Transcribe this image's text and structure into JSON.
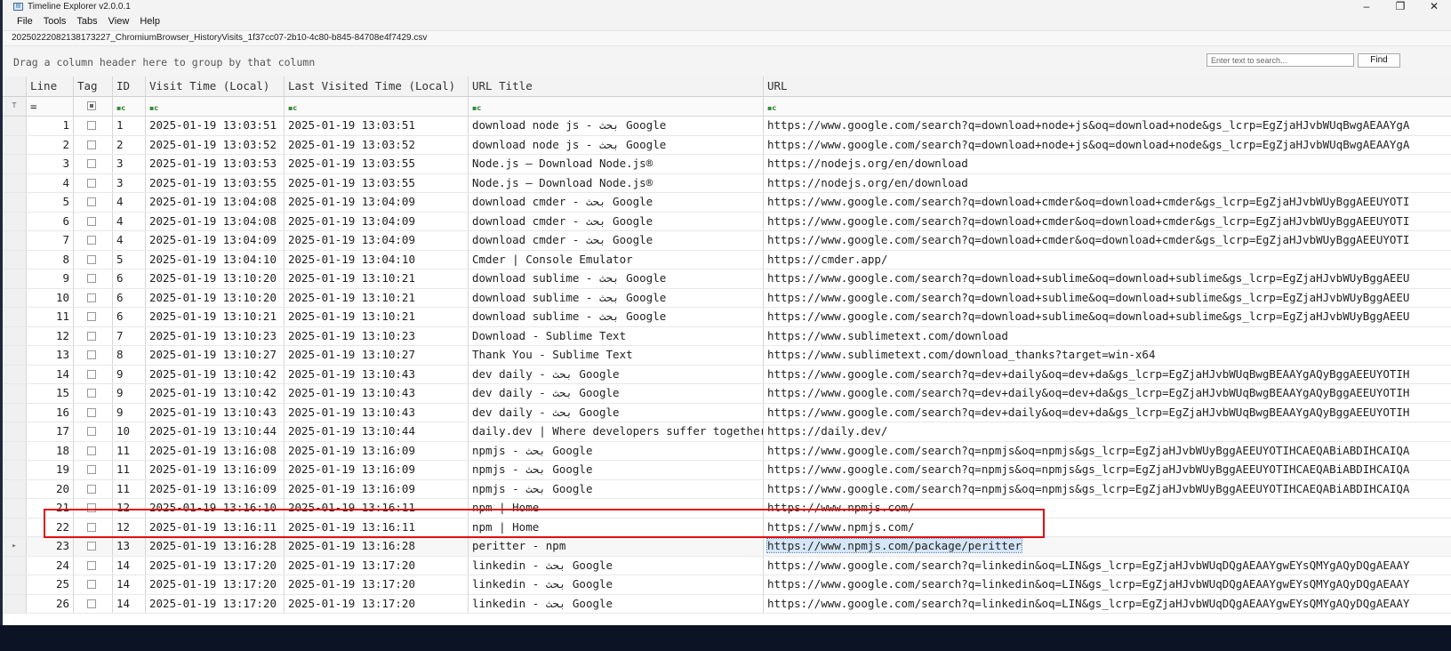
{
  "window": {
    "title": "Timeline Explorer v2.0.0.1",
    "controls": {
      "minimize": "–",
      "restore": "❐",
      "close": "✕"
    }
  },
  "menu": [
    "File",
    "Tools",
    "Tabs",
    "View",
    "Help"
  ],
  "file_tab": "20250222082138173227_ChromiumBrowser_HistoryVisits_1f37cc07-2b10-4c80-b845-84708e4f7429.csv",
  "group_hint": "Drag a column header here to group by that column",
  "search": {
    "placeholder": "Enter text to search...",
    "find_label": "Find"
  },
  "columns": {
    "line": "Line",
    "tag": "Tag",
    "id": "ID",
    "visit_time": "Visit Time (Local)",
    "last_visited": "Last Visited Time (Local)",
    "url_title": "URL Title",
    "url": "URL"
  },
  "filter_row": {
    "funnel": "⊤",
    "line_op": "=",
    "text_op": "▪c"
  },
  "rows": [
    {
      "line": "1",
      "id": "1",
      "visit": "2025-01-19 13:03:51",
      "last": "2025-01-19 13:03:51",
      "title": "download node js - بحث Google",
      "url": "https://www.google.com/search?q=download+node+js&oq=download+node&gs_lcrp=EgZjaHJvbWUqBwgAEAAYgA"
    },
    {
      "line": "2",
      "id": "2",
      "visit": "2025-01-19 13:03:52",
      "last": "2025-01-19 13:03:52",
      "title": "download node js - بحث Google",
      "url": "https://www.google.com/search?q=download+node+js&oq=download+node&gs_lcrp=EgZjaHJvbWUqBwgAEAAYgA"
    },
    {
      "line": "3",
      "id": "3",
      "visit": "2025-01-19 13:03:53",
      "last": "2025-01-19 13:03:55",
      "title": "Node.js — Download Node.js®",
      "url": "https://nodejs.org/en/download"
    },
    {
      "line": "4",
      "id": "3",
      "visit": "2025-01-19 13:03:55",
      "last": "2025-01-19 13:03:55",
      "title": "Node.js — Download Node.js®",
      "url": "https://nodejs.org/en/download"
    },
    {
      "line": "5",
      "id": "4",
      "visit": "2025-01-19 13:04:08",
      "last": "2025-01-19 13:04:09",
      "title": "download cmder - بحث Google",
      "url": "https://www.google.com/search?q=download+cmder&oq=download+cmder&gs_lcrp=EgZjaHJvbWUyBggAEEUYOTI"
    },
    {
      "line": "6",
      "id": "4",
      "visit": "2025-01-19 13:04:08",
      "last": "2025-01-19 13:04:09",
      "title": "download cmder - بحث Google",
      "url": "https://www.google.com/search?q=download+cmder&oq=download+cmder&gs_lcrp=EgZjaHJvbWUyBggAEEUYOTI"
    },
    {
      "line": "7",
      "id": "4",
      "visit": "2025-01-19 13:04:09",
      "last": "2025-01-19 13:04:09",
      "title": "download cmder - بحث Google",
      "url": "https://www.google.com/search?q=download+cmder&oq=download+cmder&gs_lcrp=EgZjaHJvbWUyBggAEEUYOTI"
    },
    {
      "line": "8",
      "id": "5",
      "visit": "2025-01-19 13:04:10",
      "last": "2025-01-19 13:04:10",
      "title": "Cmder | Console Emulator",
      "url": "https://cmder.app/"
    },
    {
      "line": "9",
      "id": "6",
      "visit": "2025-01-19 13:10:20",
      "last": "2025-01-19 13:10:21",
      "title": "download sublime - بحث Google",
      "url": "https://www.google.com/search?q=download+sublime&oq=download+sublime&gs_lcrp=EgZjaHJvbWUyBggAEEU"
    },
    {
      "line": "10",
      "id": "6",
      "visit": "2025-01-19 13:10:20",
      "last": "2025-01-19 13:10:21",
      "title": "download sublime - بحث Google",
      "url": "https://www.google.com/search?q=download+sublime&oq=download+sublime&gs_lcrp=EgZjaHJvbWUyBggAEEU"
    },
    {
      "line": "11",
      "id": "6",
      "visit": "2025-01-19 13:10:21",
      "last": "2025-01-19 13:10:21",
      "title": "download sublime - بحث Google",
      "url": "https://www.google.com/search?q=download+sublime&oq=download+sublime&gs_lcrp=EgZjaHJvbWUyBggAEEU"
    },
    {
      "line": "12",
      "id": "7",
      "visit": "2025-01-19 13:10:23",
      "last": "2025-01-19 13:10:23",
      "title": "Download - Sublime Text",
      "url": "https://www.sublimetext.com/download"
    },
    {
      "line": "13",
      "id": "8",
      "visit": "2025-01-19 13:10:27",
      "last": "2025-01-19 13:10:27",
      "title": "Thank You - Sublime Text",
      "url": "https://www.sublimetext.com/download_thanks?target=win-x64"
    },
    {
      "line": "14",
      "id": "9",
      "visit": "2025-01-19 13:10:42",
      "last": "2025-01-19 13:10:43",
      "title": "dev daily - بحث Google",
      "url": "https://www.google.com/search?q=dev+daily&oq=dev+da&gs_lcrp=EgZjaHJvbWUqBwgBEAAYgAQyBggAEEUYOTIH"
    },
    {
      "line": "15",
      "id": "9",
      "visit": "2025-01-19 13:10:42",
      "last": "2025-01-19 13:10:43",
      "title": "dev daily - بحث Google",
      "url": "https://www.google.com/search?q=dev+daily&oq=dev+da&gs_lcrp=EgZjaHJvbWUqBwgBEAAYgAQyBggAEEUYOTIH"
    },
    {
      "line": "16",
      "id": "9",
      "visit": "2025-01-19 13:10:43",
      "last": "2025-01-19 13:10:43",
      "title": "dev daily - بحث Google",
      "url": "https://www.google.com/search?q=dev+daily&oq=dev+da&gs_lcrp=EgZjaHJvbWUqBwgBEAAYgAQyBggAEEUYOTIH"
    },
    {
      "line": "17",
      "id": "10",
      "visit": "2025-01-19 13:10:44",
      "last": "2025-01-19 13:10:44",
      "title": "daily.dev | Where developers suffer together",
      "url": "https://daily.dev/"
    },
    {
      "line": "18",
      "id": "11",
      "visit": "2025-01-19 13:16:08",
      "last": "2025-01-19 13:16:09",
      "title": "npmjs - بحث Google",
      "url": "https://www.google.com/search?q=npmjs&oq=npmjs&gs_lcrp=EgZjaHJvbWUyBggAEEUYOTIHCAEQABiABDIHCAIQA"
    },
    {
      "line": "19",
      "id": "11",
      "visit": "2025-01-19 13:16:09",
      "last": "2025-01-19 13:16:09",
      "title": "npmjs - بحث Google",
      "url": "https://www.google.com/search?q=npmjs&oq=npmjs&gs_lcrp=EgZjaHJvbWUyBggAEEUYOTIHCAEQABiABDIHCAIQA"
    },
    {
      "line": "20",
      "id": "11",
      "visit": "2025-01-19 13:16:09",
      "last": "2025-01-19 13:16:09",
      "title": "npmjs - بحث Google",
      "url": "https://www.google.com/search?q=npmjs&oq=npmjs&gs_lcrp=EgZjaHJvbWUyBggAEEUYOTIHCAEQABiABDIHCAIQA"
    },
    {
      "line": "21",
      "id": "12",
      "visit": "2025-01-19 13:16:10",
      "last": "2025-01-19 13:16:11",
      "title": "npm | Home",
      "url": "https://www.npmjs.com/"
    },
    {
      "line": "22",
      "id": "12",
      "visit": "2025-01-19 13:16:11",
      "last": "2025-01-19 13:16:11",
      "title": "npm | Home",
      "url": "https://www.npmjs.com/"
    },
    {
      "line": "23",
      "id": "13",
      "visit": "2025-01-19 13:16:28",
      "last": "2025-01-19 13:16:28",
      "title": "peritter - npm",
      "url": "https://www.npmjs.com/package/peritter",
      "selected": true
    },
    {
      "line": "24",
      "id": "14",
      "visit": "2025-01-19 13:17:20",
      "last": "2025-01-19 13:17:20",
      "title": "linkedin - بحث Google",
      "url": "https://www.google.com/search?q=linkedin&oq=LIN&gs_lcrp=EgZjaHJvbWUqDQgAEAAYgwEYsQMYgAQyDQgAEAAY"
    },
    {
      "line": "25",
      "id": "14",
      "visit": "2025-01-19 13:17:20",
      "last": "2025-01-19 13:17:20",
      "title": "linkedin - بحث Google",
      "url": "https://www.google.com/search?q=linkedin&oq=LIN&gs_lcrp=EgZjaHJvbWUqDQgAEAAYgwEYsQMYgAQyDQgAEAAY"
    },
    {
      "line": "26",
      "id": "14",
      "visit": "2025-01-19 13:17:20",
      "last": "2025-01-19 13:17:20",
      "title": "linkedin - بحث Google",
      "url": "https://www.google.com/search?q=linkedin&oq=LIN&gs_lcrp=EgZjaHJvbWUqDQgAEAAYgwEYsQMYgAQyDQgAEAAY"
    }
  ],
  "selection_marker": "▸",
  "highlight_color": "#e01010",
  "selected_cell_color": "#d5e6f7"
}
